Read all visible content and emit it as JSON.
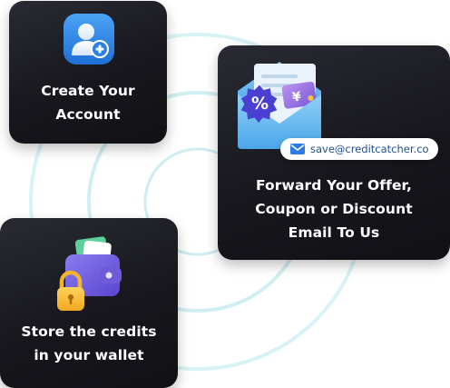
{
  "steps": [
    {
      "title_line1": "Create Your",
      "title_line2": "Account",
      "icon": "user-add-icon"
    },
    {
      "title_line1": "Forward Your Offer,",
      "title_line2": "Coupon or Discount",
      "title_line3": "Email To Us",
      "icon": "discount-envelope-icon"
    },
    {
      "title_line1": "Store the credits",
      "title_line2": "in your wallet",
      "icon": "locked-wallet-icon"
    }
  ],
  "email_badge": {
    "text": "save@creditcatcher.co",
    "icon": "mail-icon"
  },
  "colors": {
    "card_dark": "#17171d",
    "ring": "#cdeff1",
    "accent_blue": "#2c7be5",
    "email_text": "#1e4f8e"
  }
}
